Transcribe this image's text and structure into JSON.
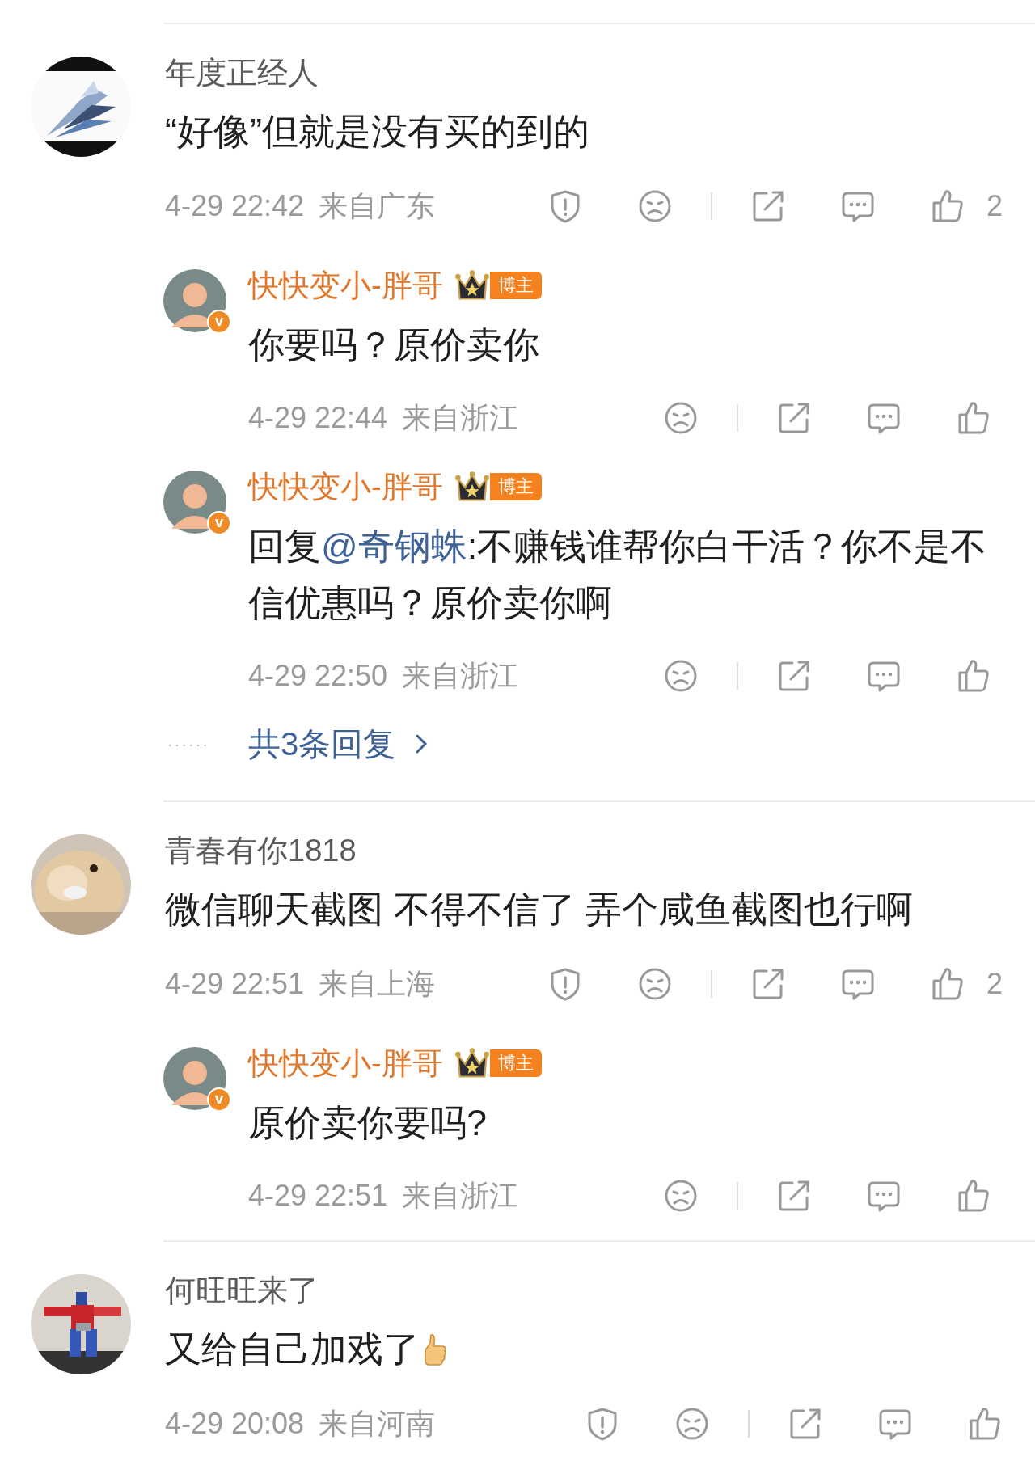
{
  "comments": [
    {
      "name": "年度正经人",
      "segments": [
        {
          "kind": "text",
          "text": "“好像”但就是没有买的到的"
        }
      ],
      "emoji": false,
      "time": "4-29 22:42",
      "location": "来自广东",
      "likes": "2",
      "replies": [
        {
          "name": "快快变小-胖哥",
          "verified_badge": "v",
          "role_badge": "博主",
          "segments": [
            {
              "kind": "text",
              "text": "你要吗？原价卖你"
            }
          ],
          "time": "4-29 22:44",
          "location": "来自浙江"
        },
        {
          "name": "快快变小-胖哥",
          "verified_badge": "v",
          "role_badge": "博主",
          "segments": [
            {
              "kind": "text",
              "text": "回复"
            },
            {
              "kind": "mention",
              "text": "@奇钢蛛"
            },
            {
              "kind": "text",
              "text": ":不赚钱谁帮你白干活？你不是不信优惠吗？原价卖你啊"
            }
          ],
          "time": "4-29 22:50",
          "location": "来自浙江"
        }
      ],
      "more": {
        "dots": "······",
        "label": "共3条回复"
      }
    },
    {
      "name": "青春有你1818",
      "segments": [
        {
          "kind": "text",
          "text": "微信聊天截图 不得不信了 弄个咸鱼截图也行啊"
        }
      ],
      "emoji": false,
      "time": "4-29 22:51",
      "location": "来自上海",
      "likes": "2",
      "replies": [
        {
          "name": "快快变小-胖哥",
          "verified_badge": "v",
          "role_badge": "博主",
          "segments": [
            {
              "kind": "text",
              "text": "原价卖你要吗?"
            }
          ],
          "time": "4-29 22:51",
          "location": "来自浙江"
        }
      ]
    },
    {
      "name": "何旺旺来了",
      "segments": [
        {
          "kind": "text",
          "text": "又给自己加戏了"
        }
      ],
      "emoji": true,
      "time": "4-29 20:08",
      "location": "来自河南"
    }
  ]
}
